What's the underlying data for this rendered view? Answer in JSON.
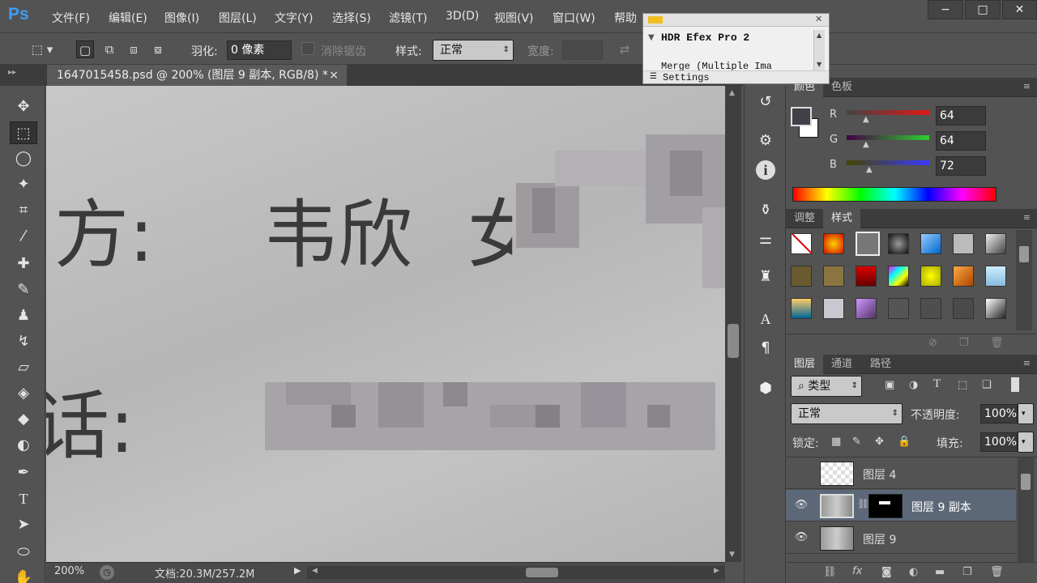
{
  "app": {
    "logo": "Ps"
  },
  "menu": [
    "文件(F)",
    "编辑(E)",
    "图像(I)",
    "图层(L)",
    "文字(Y)",
    "选择(S)",
    "滤镜(T)",
    "3D(D)",
    "视图(V)",
    "窗口(W)",
    "帮助"
  ],
  "window_controls": {
    "minimize": "−",
    "maximize": "□",
    "close": "✕"
  },
  "options": {
    "feather_label": "羽化:",
    "feather_value": "0 像素",
    "antialias_label": "消除锯齿",
    "style_label": "样式:",
    "style_value": "正常",
    "width_label": "宽度:"
  },
  "document": {
    "tab_title": "1647015458.psd @ 200% (图层 9 副本, RGB/8) *",
    "close": "×"
  },
  "canvas_text": {
    "line1_a": "方:",
    "line1_b": "韦欣",
    "line2_a": "话:"
  },
  "status": {
    "zoom": "200%",
    "doc_info": "文档:20.3M/257.2M"
  },
  "hdr": {
    "title": "HDR Efex Pro 2",
    "item": "Merge (Multiple Ima",
    "settings": "Settings"
  },
  "color_panel": {
    "tabs": [
      "颜色",
      "色板"
    ],
    "r_label": "R",
    "r": "64",
    "g_label": "G",
    "g": "64",
    "b_label": "B",
    "b": "72",
    "foreground": "#404048"
  },
  "styles_panel": {
    "tabs": [
      "调整",
      "样式"
    ]
  },
  "layers_panel": {
    "tabs": [
      "图层",
      "通道",
      "路径"
    ],
    "filter_label": "类型",
    "blend_mode": "正常",
    "opacity_label": "不透明度:",
    "opacity": "100%",
    "lock_label": "锁定:",
    "fill_label": "填充:",
    "fill": "100%",
    "layers": [
      {
        "name": "图层 4",
        "visible": false,
        "selected": false
      },
      {
        "name": "图层 9 副本",
        "visible": true,
        "selected": true
      },
      {
        "name": "图层 9",
        "visible": true,
        "selected": false
      }
    ]
  }
}
